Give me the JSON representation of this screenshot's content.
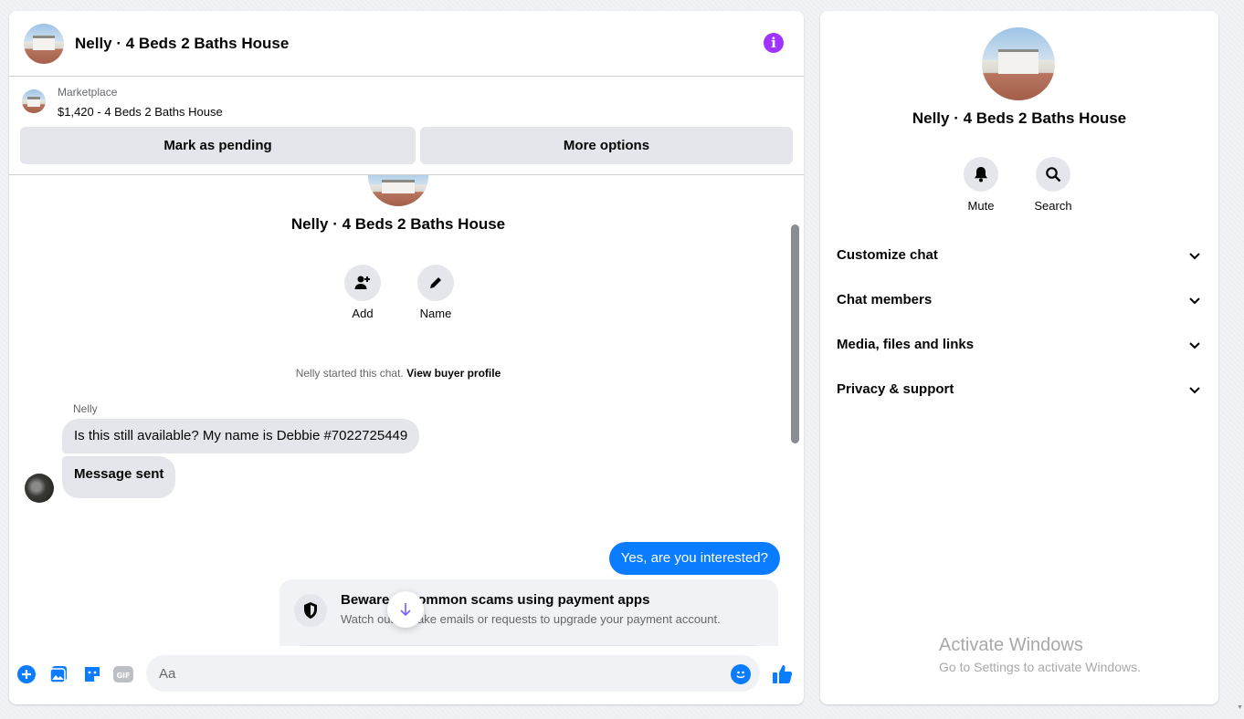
{
  "chat": {
    "title": "Nelly · 4 Beds 2 Baths House",
    "info_icon": "info-icon"
  },
  "marketplace": {
    "label": "Marketplace",
    "listing": "$1,420 - 4 Beds 2 Baths House",
    "mark_pending": "Mark as pending",
    "more_options": "More options"
  },
  "thread": {
    "title": "Nelly · 4 Beds 2 Baths House",
    "add_label": "Add",
    "name_label": "Name",
    "started_text": "Nelly started this chat.",
    "view_profile": "View buyer profile",
    "sender_name": "Nelly",
    "messages": [
      {
        "from": "Nelly",
        "text": "Is this still available? My name is Debbie #7022725449"
      },
      {
        "from": "Nelly",
        "text": "Message sent"
      },
      {
        "from": "me",
        "text": "Yes, are you interested?"
      }
    ],
    "scam_notice": {
      "title": "Beware of common scams using payment apps",
      "body": "Watch out for fake emails or requests to upgrade your payment account."
    }
  },
  "composer": {
    "placeholder": "Aa",
    "icons": [
      "plus-icon",
      "photo-icon",
      "sticker-icon",
      "gif-icon",
      "emoji-icon",
      "thumbs-up-icon"
    ],
    "gif_label": "GIF"
  },
  "info_panel": {
    "title": "Nelly · 4 Beds 2 Baths House",
    "mute_label": "Mute",
    "search_label": "Search",
    "sections": [
      {
        "label": "Customize chat"
      },
      {
        "label": "Chat members"
      },
      {
        "label": "Media, files and links"
      },
      {
        "label": "Privacy & support"
      }
    ]
  },
  "watermark": {
    "line1": "Activate Windows",
    "line2": "Go to Settings to activate Windows."
  },
  "colors": {
    "accent": "#0a7cff",
    "info": "#a033ff",
    "bubble_in": "#e4e6eb"
  }
}
